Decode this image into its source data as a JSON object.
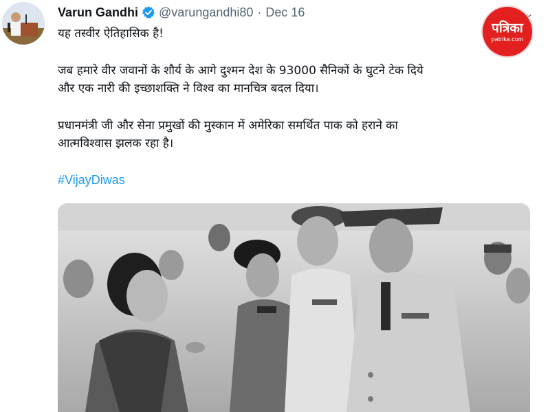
{
  "author": {
    "name": "Varun Gandhi",
    "handle": "@varungandhi80",
    "separator": "·",
    "date": "Dec 16",
    "verified_icon": "verified-badge-icon",
    "avatar_icon": "profile-avatar"
  },
  "menu_icon": "chevron-down-icon",
  "watermark": {
    "brand": "पत्रिका",
    "domain": "patrika.com"
  },
  "tweet": {
    "line1": "यह तस्वीर ऐतिहासिक है!",
    "line2a": "जब हमारे वीर जवानों के शौर्य के आगे दुश्मन देश के 93000 सैनिकों के घुटने टेक दिये",
    "line2b": "और एक नारी की इच्छाशक्ति ने विश्व का मानचित्र बदल दिया।",
    "line3a": "प्रधानमंत्री जी और सेना प्रमुखों की मुस्कान में अमेरिका समर्थित पाक को हराने का",
    "line3b": "आत्मविश्वास झलक रहा है।",
    "hashtag": "#VijayDiwas"
  },
  "colors": {
    "link": "#1d9bf0",
    "verified": "#1d9bf0",
    "secondary_text": "#536471",
    "logo_red": "#e1201f"
  },
  "media": {
    "type": "photo",
    "style": "black-and-white"
  }
}
